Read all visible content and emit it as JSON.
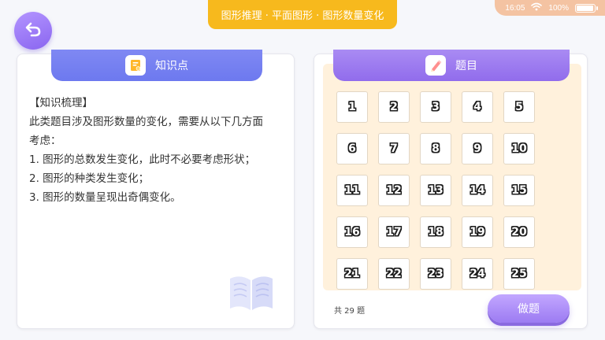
{
  "status_bar": {
    "time": "16:05",
    "battery": "100%",
    "battery_level": 1.0
  },
  "header": {
    "breadcrumb": "图形推理 · 平面图形 · 图形数量变化"
  },
  "knowledge_panel": {
    "title": "知识点",
    "lines": [
      "【知识梳理】",
      "此类题目涉及图形数量的变化，需要从以下几方面",
      "考虑：",
      "1. 图形的总数发生变化，此时不必要考虑形状；",
      "2. 图形的种类发生变化；",
      "3. 图形的数量呈现出奇偶变化。"
    ]
  },
  "questions_panel": {
    "title": "题目",
    "numbers": [
      "1",
      "2",
      "3",
      "4",
      "5",
      "6",
      "7",
      "8",
      "9",
      "10",
      "11",
      "12",
      "13",
      "14",
      "15",
      "16",
      "17",
      "18",
      "19",
      "20",
      "21",
      "22",
      "23",
      "24",
      "25"
    ],
    "total_label": "共 29 题",
    "start_button": "做题"
  },
  "colors": {
    "accent_yellow": "#f7b91d",
    "accent_blue": "#6d79ef",
    "accent_purple": "#916cec",
    "grid_bg": "#fff1dc"
  },
  "icons": {
    "back": "back-arrow-icon",
    "knowledge": "note-icon",
    "questions": "pencil-icon",
    "decor": "open-book-icon",
    "wifi": "wifi-icon",
    "battery": "battery-icon"
  }
}
